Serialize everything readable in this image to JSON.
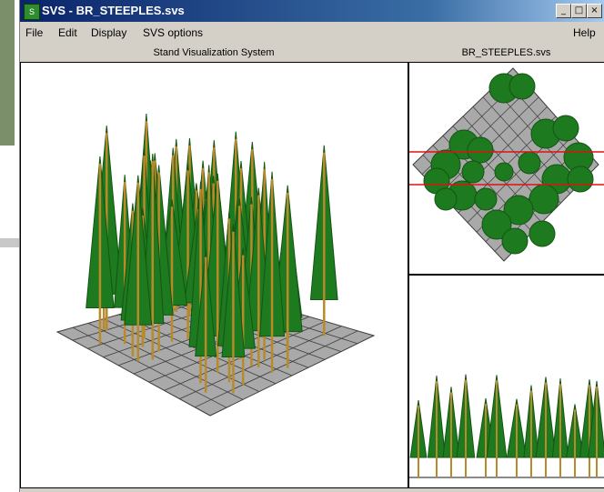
{
  "window": {
    "title": "SVS - BR_STEEPLES.svs",
    "controls": {
      "minimize": "_",
      "maximize": "□",
      "close": "×"
    }
  },
  "menu": {
    "file": "File",
    "edit": "Edit",
    "display": "Display",
    "svs_options": "SVS options",
    "help": "Help"
  },
  "panes": {
    "main_header": "Stand Visualization System",
    "side_header": "BR_STEEPLES.svs"
  },
  "colors": {
    "foliage": "#1e7a1e",
    "foliage_dark": "#145414",
    "trunk": "#b88a2a",
    "grid_fill": "#a9a9a9",
    "grid_line": "#3c3c3c",
    "selection_line": "#e01010"
  },
  "icons": [
    "svs-app-icon",
    "minimize-icon",
    "maximize-icon",
    "close-icon"
  ]
}
